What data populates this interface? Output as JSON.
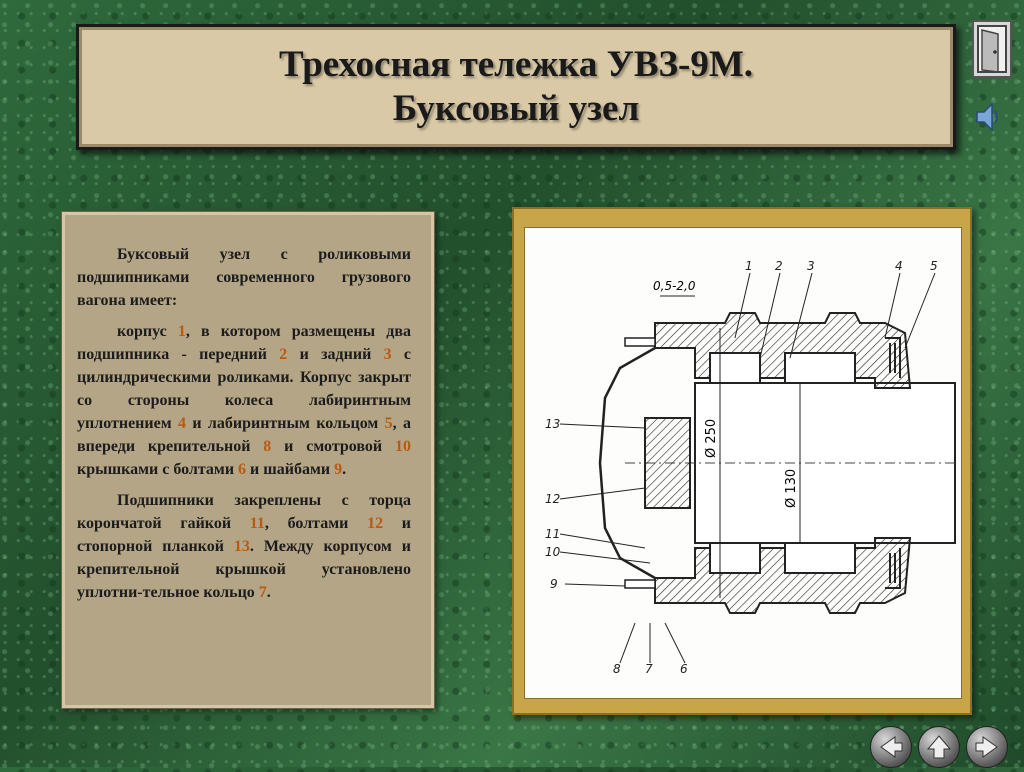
{
  "title": {
    "line1": "Трехосная тележка УВЗ-9М.",
    "line2": "Буксовый узел"
  },
  "buttons": {
    "exit_icon": "door-icon",
    "sound_icon": "speaker-icon",
    "prev_icon": "arrow-left-icon",
    "home_icon": "arrow-up-icon",
    "next_icon": "arrow-right-icon"
  },
  "text": {
    "p1": "Буксовый узел с роликовыми подшипниками современного грузового вагона имеет:",
    "p2": {
      "s1": "корпус ",
      "n1": "1",
      "s2": ", в котором размещены два подшипника - передний ",
      "n2": "2",
      "s3": " и задний ",
      "n3": "3",
      "s4": " с цилиндрическими роликами. Корпус закрыт со стороны колеса лабиринтным уплотнением ",
      "n4": "4",
      "s5": " и лабиринтным кольцом ",
      "n5": "5",
      "s6": ", а впереди крепительной ",
      "n6": "8",
      "s7": " и смотровой ",
      "n7": "10",
      "s8": " крышками с болтами ",
      "n8": "6",
      "s9": " и шайбами ",
      "n9": "9",
      "s10": "."
    },
    "p3": {
      "s1": "Подшипники закреплены с торца корончатой гайкой ",
      "n1": "11",
      "s2": ", болтами ",
      "n2": "12",
      "s3": " и стопорной планкой ",
      "n3": "13",
      "s4": ". Между корпусом и крепительной крышкой установлено уплотни-тельное кольцо ",
      "n4": "7",
      "s5": "."
    }
  },
  "figure": {
    "dim_gap": "0,5-2,0",
    "dim_outer": "Ø 250",
    "dim_inner": "Ø 130",
    "labels": [
      "1",
      "2",
      "3",
      "4",
      "5",
      "13",
      "12",
      "11",
      "10",
      "9",
      "8",
      "7",
      "6"
    ]
  },
  "colors": {
    "accent_number": "#b85a10",
    "title_bg": "#d9c9a6",
    "panel_bg": "#b4a587",
    "frame_gold": "#c9a54a"
  }
}
